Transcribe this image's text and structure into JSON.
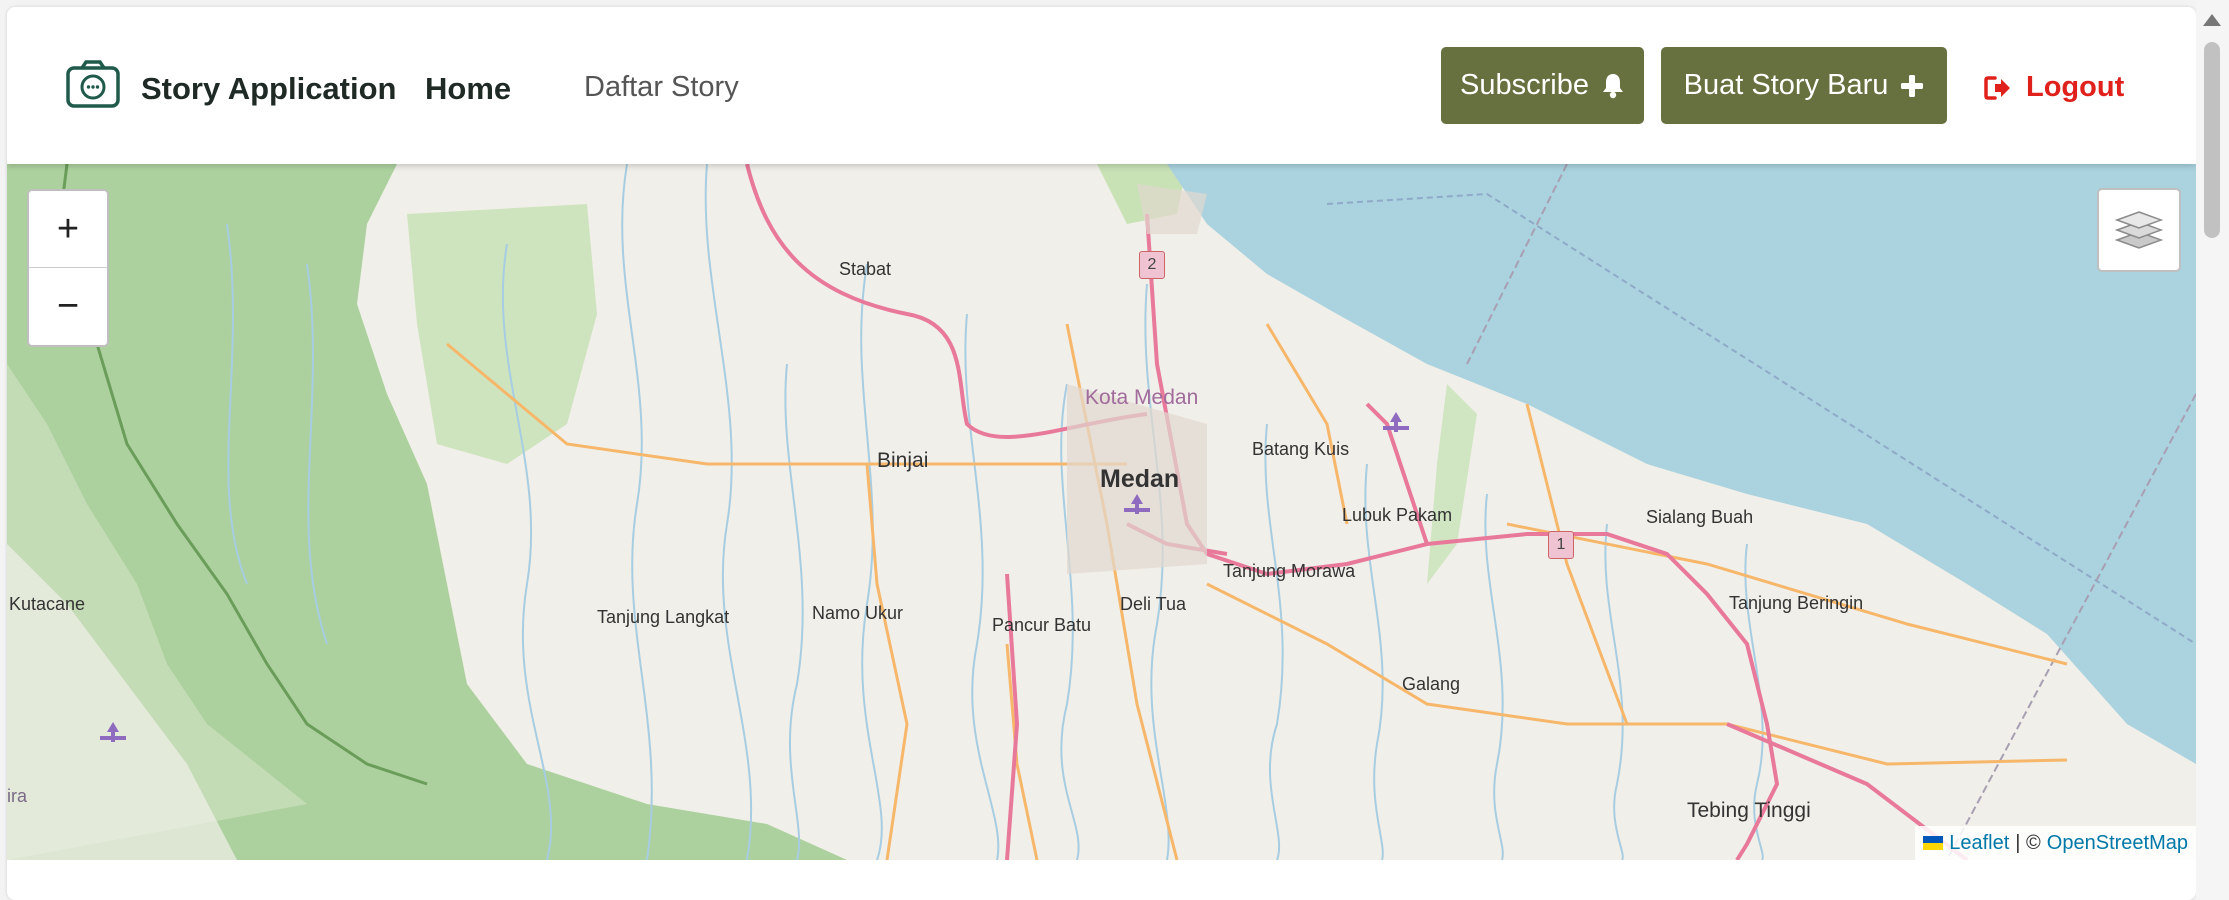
{
  "header": {
    "brand_title": "Story Application",
    "nav": {
      "home": "Home",
      "stories": "Daftar Story"
    },
    "subscribe_label": "Subscribe",
    "new_story_label": "Buat Story Baru",
    "logout_label": "Logout"
  },
  "map": {
    "zoom_in": "+",
    "zoom_out": "−",
    "attribution": {
      "leaflet": "Leaflet",
      "separator": "| ©",
      "osm": "OpenStreetMap"
    },
    "places": {
      "stabat": "Stabat",
      "kota_medan": "Kota Medan",
      "binjai": "Binjai",
      "medan": "Medan",
      "batang_kuis": "Batang Kuis",
      "lubuk_pakam": "Lubuk Pakam",
      "sialang_buah": "Sialang Buah",
      "tanjung_morawa": "Tanjung Morawa",
      "kutacane": "Kutacane",
      "tanjung_langkat": "Tanjung Langkat",
      "namo_ukur": "Namo Ukur",
      "pancur_batu": "Pancur Batu",
      "deli_tua": "Deli Tua",
      "tanjung_beringin": "Tanjung Beringin",
      "galang": "Galang",
      "tebing_tinggi": "Tebing Tinggi",
      "ira": "ira"
    },
    "road_shields": {
      "r2": "2",
      "r1": "1"
    }
  },
  "colors": {
    "accent_button": "#67703f",
    "logout": "#e0201b",
    "sea": "#aad3df",
    "forest": "#add19e",
    "land": "#f1efe9"
  }
}
